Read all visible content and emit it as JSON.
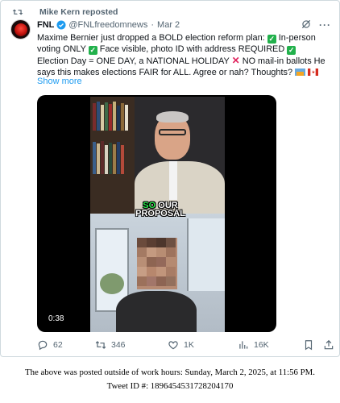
{
  "repost_label": "Mike Kern reposted",
  "post": {
    "display_name": "FNL",
    "handle": "@FNLfreedomnews",
    "separator": "·",
    "date": "Mar 2",
    "text": {
      "part1": "Maxime Bernier just dropped a BOLD election reform plan: ",
      "part2": " In-person voting ONLY ",
      "part3": " Face visible, photo ID with address REQUIRED ",
      "part4": " Election Day = ONE DAY, a NATIONAL HOLIDAY ",
      "part5": " NO mail-in ballots He says this makes elections FAIR for ALL. Agree or nah? Thoughts? "
    },
    "show_more": "Show more"
  },
  "video": {
    "caption_line1_highlight": "SO",
    "caption_line1_rest": " OUR",
    "caption_line2": "PROPOSAL",
    "timestamp": "0:38"
  },
  "actions": {
    "replies": "62",
    "reposts": "346",
    "likes": "1K",
    "views": "16K"
  },
  "footer": {
    "line1": "The above was posted outside of work hours: Sunday, March 2, 2025, at 11:56 PM.",
    "line2": "Tweet ID #: 1896454531728204170"
  },
  "colors": {
    "accent": "#1d9bf0",
    "muted": "#536471",
    "check_green": "#22b14c",
    "caption_green": "#27e64a"
  },
  "icons": [
    "repost-icon",
    "verified-icon",
    "grok-icon",
    "more-icon",
    "reply-icon",
    "retweet-icon",
    "like-icon",
    "views-icon",
    "bookmark-icon",
    "share-icon"
  ]
}
